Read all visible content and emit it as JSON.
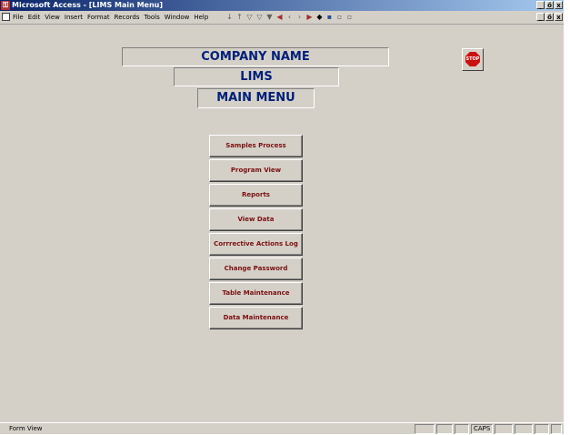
{
  "window": {
    "title": "Microsoft Access - [LIMS Main Menu]",
    "minimize": "_",
    "restore": "ő",
    "close": "x"
  },
  "menubar": {
    "items": [
      "File",
      "Edit",
      "View",
      "Insert",
      "Format",
      "Records",
      "Tools",
      "Window",
      "Help"
    ],
    "toolbar_icons": [
      "sort-asc-icon",
      "sort-desc-icon",
      "filter-selection-icon",
      "filter-form-icon",
      "apply-filter-icon",
      "first-record-icon",
      "prev-record-icon",
      "next-record-icon",
      "last-record-icon",
      "find-icon",
      "new-object-icon",
      "delete-icon",
      "properties-icon"
    ]
  },
  "form": {
    "company_name": "COMPANY NAME",
    "app_name": "LIMS",
    "menu_title": "MAIN MENU",
    "stop_label": "STOP",
    "buttons": [
      "Samples Process",
      "Program View",
      "Reports",
      "View Data",
      "Corrrective Actions Log",
      "Change Password",
      "Table Maintenance",
      "Data Maintenance"
    ]
  },
  "statusbar": {
    "mode": "Form View",
    "caps": "CAPS"
  },
  "colors": {
    "title_text": "#001f7a",
    "button_text": "#7a1010",
    "face": "#d4d0c8"
  }
}
